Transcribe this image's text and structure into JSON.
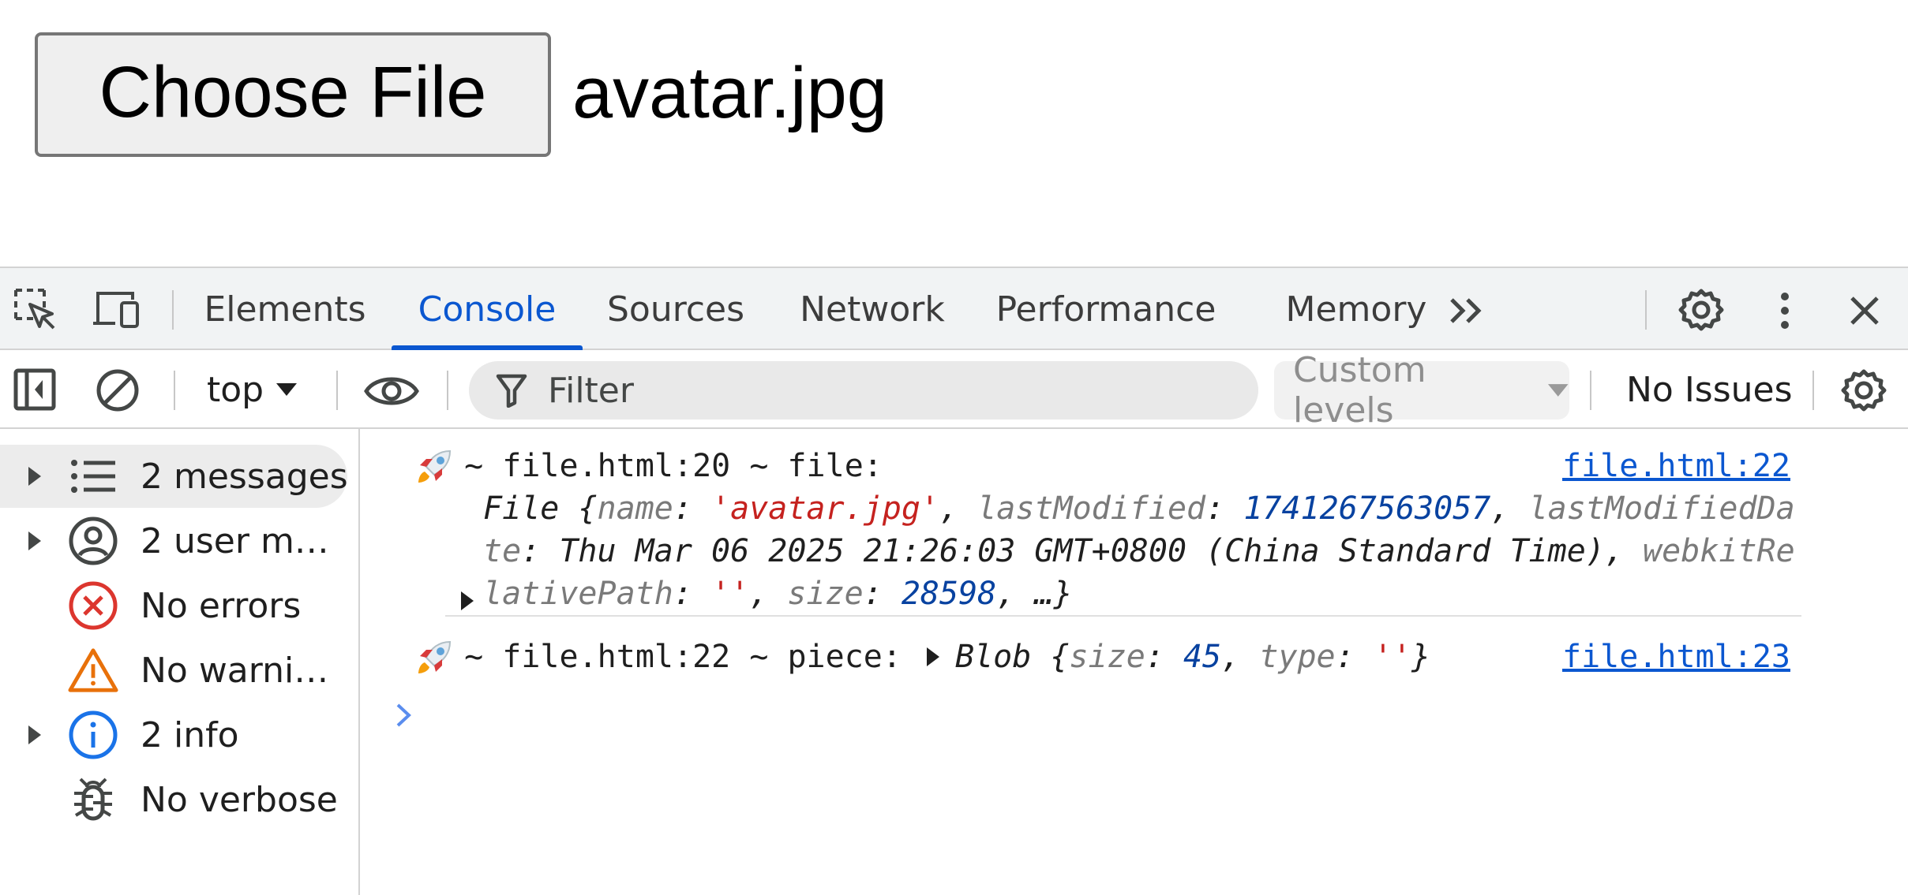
{
  "page": {
    "file_button_label": "Choose File",
    "file_name": "avatar.jpg"
  },
  "devtools": {
    "tabs": [
      {
        "label": "Elements"
      },
      {
        "label": "Console"
      },
      {
        "label": "Sources"
      },
      {
        "label": "Network"
      },
      {
        "label": "Performance"
      },
      {
        "label": "Memory"
      }
    ],
    "active_tab": "Console",
    "toolbar": {
      "context": "top",
      "filter_placeholder": "Filter",
      "levels": "Custom levels",
      "issues": "No Issues"
    },
    "sidebar": [
      {
        "label": "2 messages",
        "icon": "list-icon",
        "expandable": true,
        "selected": true
      },
      {
        "label": "2 user m…",
        "icon": "user-icon",
        "expandable": true,
        "selected": false
      },
      {
        "label": "No errors",
        "icon": "error-icon",
        "expandable": false,
        "selected": false
      },
      {
        "label": "No warni…",
        "icon": "warning-icon",
        "expandable": false,
        "selected": false
      },
      {
        "label": "2 info",
        "icon": "info-icon",
        "expandable": true,
        "selected": false
      },
      {
        "label": "No verbose",
        "icon": "bug-icon",
        "expandable": false,
        "selected": false
      }
    ],
    "messages": [
      {
        "head": " ~ file.html:20 ~ file:",
        "source": "file.html:22",
        "object": {
          "prefix": "File {",
          "name_key": "name",
          "name_val": "'avatar.jpg'",
          "lm_key": "lastModified",
          "lm_val": "1741267563057",
          "lmd_key": "lastModifiedDate",
          "lmd_val": "Thu Mar 06 2025 21:26:03 GMT+0800 (China Standard Time)",
          "wrp_key": "webkitRelativePath",
          "wrp_val": "''",
          "size_key": "size",
          "size_val": "28598",
          "suffix": ", …}"
        }
      },
      {
        "head": " ~ file.html:22 ~ piece:",
        "source": "file.html:23",
        "object": {
          "prefix": "Blob {",
          "size_key": "size",
          "size_val": "45",
          "type_key": "type",
          "type_val": "''",
          "suffix": "}"
        }
      }
    ],
    "colors": {
      "accent": "#0b57d0",
      "error": "#dc362e",
      "warning": "#e8710a",
      "info": "#1a73e8"
    }
  }
}
